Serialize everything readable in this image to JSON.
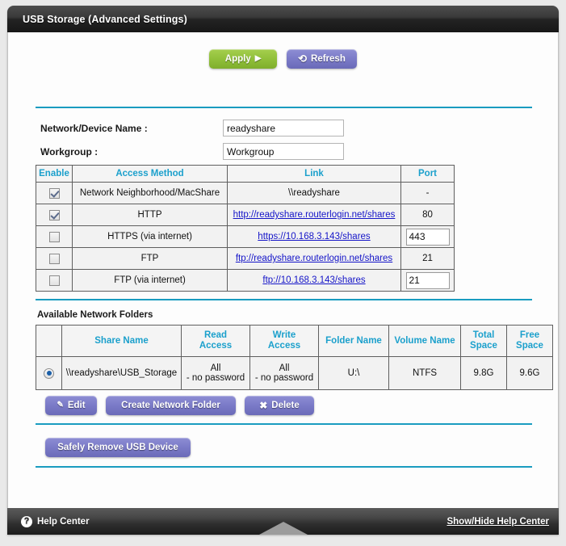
{
  "window": {
    "title": "USB Storage (Advanced Settings)"
  },
  "toolbar": {
    "apply_label": "Apply",
    "apply_icon": "play-triangle-icon",
    "refresh_label": "Refresh",
    "refresh_icon": "refresh-circular-arrow-icon"
  },
  "form": {
    "network_device_name_label": "Network/Device Name :",
    "network_device_name_value": "readyshare",
    "workgroup_label": "Workgroup :",
    "workgroup_value": "Workgroup"
  },
  "access_table": {
    "headers": [
      "Enable",
      "Access Method",
      "Link",
      "Port"
    ],
    "rows": [
      {
        "enabled": true,
        "method": "Network Neighborhood/MacShare",
        "link": "\\\\readyshare",
        "link_is_url": false,
        "port": "-",
        "port_editable": false
      },
      {
        "enabled": true,
        "method": "HTTP",
        "link": "http://readyshare.routerlogin.net/shares",
        "link_is_url": true,
        "port": "80",
        "port_editable": false
      },
      {
        "enabled": false,
        "method": "HTTPS (via internet)",
        "link": "https://10.168.3.143/shares",
        "link_is_url": true,
        "port": "443",
        "port_editable": true
      },
      {
        "enabled": false,
        "method": "FTP",
        "link": "ftp://readyshare.routerlogin.net/shares",
        "link_is_url": true,
        "port": "21",
        "port_editable": false
      },
      {
        "enabled": false,
        "method": "FTP (via internet)",
        "link": "ftp://10.168.3.143/shares",
        "link_is_url": true,
        "port": "21",
        "port_editable": true
      }
    ]
  },
  "folders": {
    "section_title": "Available Network Folders",
    "headers": [
      "",
      "Share Name",
      "Read Access",
      "Write Access",
      "Folder Name",
      "Volume Name",
      "Total Space",
      "Free Space"
    ],
    "headers_wrapped": [
      {
        "line1": "",
        "line2": ""
      },
      {
        "line1": "Share Name",
        "line2": ""
      },
      {
        "line1": "Read",
        "line2": "Access"
      },
      {
        "line1": "Write",
        "line2": "Access"
      },
      {
        "line1": "Folder Name",
        "line2": ""
      },
      {
        "line1": "Volume Name",
        "line2": ""
      },
      {
        "line1": "Total",
        "line2": "Space"
      },
      {
        "line1": "Free",
        "line2": "Space"
      }
    ],
    "rows": [
      {
        "selected": true,
        "share_name": "\\\\readyshare\\USB_Storage",
        "read_access_line1": "All",
        "read_access_line2": "- no password",
        "write_access_line1": "All",
        "write_access_line2": "- no password",
        "folder_name": "U:\\",
        "volume_name": "NTFS",
        "total_space": "9.8G",
        "free_space": "9.6G"
      }
    ]
  },
  "folder_actions": {
    "edit_label": "Edit",
    "edit_icon": "pencil-icon",
    "create_label": "Create Network Folder",
    "delete_label": "Delete",
    "delete_icon": "x-close-icon"
  },
  "device_actions": {
    "safely_remove_label": "Safely Remove USB Device"
  },
  "footer": {
    "help_center_label": "Help Center",
    "help_icon": "question-mark-circle-icon",
    "show_hide_label": "Show/Hide Help Center",
    "collapse_icon": "triangle-up-icon"
  },
  "colors": {
    "accent_teal": "#1a9cc0",
    "header_blue": "#1ba0cc",
    "apply_green": "#91c03a",
    "button_purple": "#7b7bc8",
    "link_blue": "#1414c8"
  }
}
